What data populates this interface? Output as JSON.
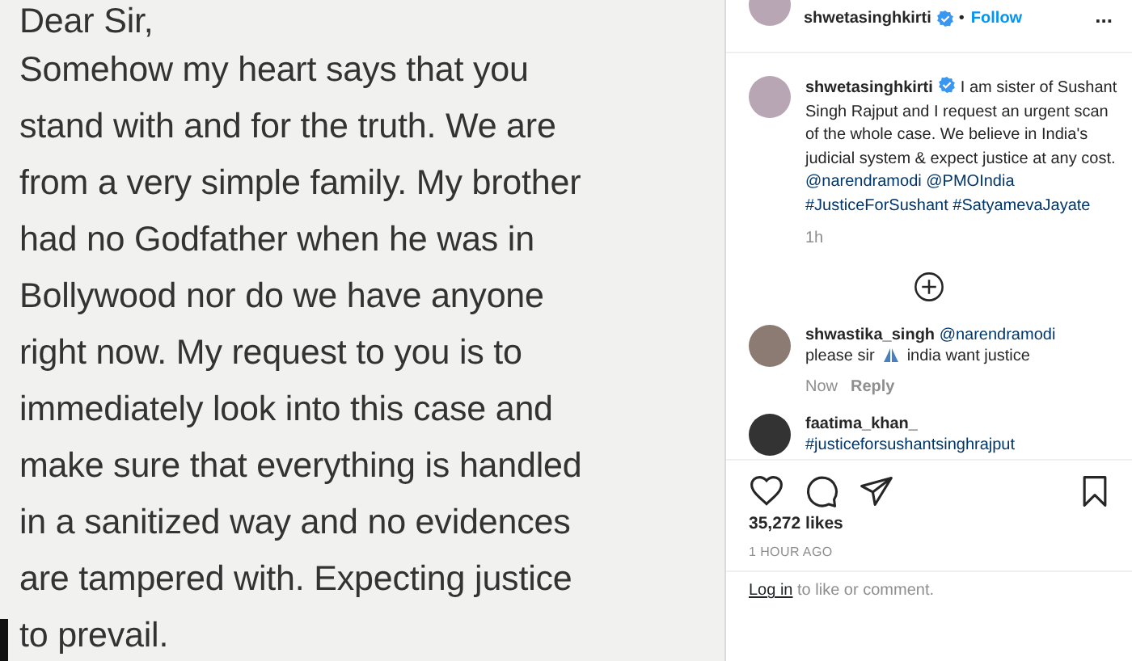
{
  "letter": {
    "lines": [
      "Dear Sir,",
      "Somehow my heart says that you",
      "stand with and for the truth. We are",
      "from a very simple family. My brother",
      "had no Godfather when he was in",
      "Bollywood nor do we have anyone",
      "right now. My request to you is to",
      "immediately look into this case and",
      "make sure that everything is handled",
      "in a sanitized way and no evidences",
      "are tampered with.  Expecting justice",
      "to prevail."
    ]
  },
  "header": {
    "username": "shwetasinghkirti",
    "verified": true,
    "separator": "•",
    "follow": "Follow",
    "more": "..."
  },
  "caption": {
    "username": "shwetasinghkirti",
    "verified": true,
    "text": "I am sister of Sushant Singh Rajput and I request an urgent scan of the whole case. We believe in India's judicial system & expect justice at any cost.",
    "links": [
      "@narendramodi",
      "@PMOIndia",
      "#JusticeForSushant",
      "#SatyamevaJayate"
    ],
    "time": "1h"
  },
  "comments": [
    {
      "username": "shwastika_singh",
      "mention": "@narendramodi",
      "text_before": "please sir",
      "text_after": "india want justice",
      "time": "Now",
      "reply": "Reply"
    },
    {
      "username": "faatima_khan_",
      "text": "#justiceforsushantsinghrajput"
    }
  ],
  "actions": {
    "saved": false
  },
  "likes": "35,272 likes",
  "posted": "1 HOUR AGO",
  "login": {
    "link": "Log in",
    "text": "to like or comment."
  }
}
